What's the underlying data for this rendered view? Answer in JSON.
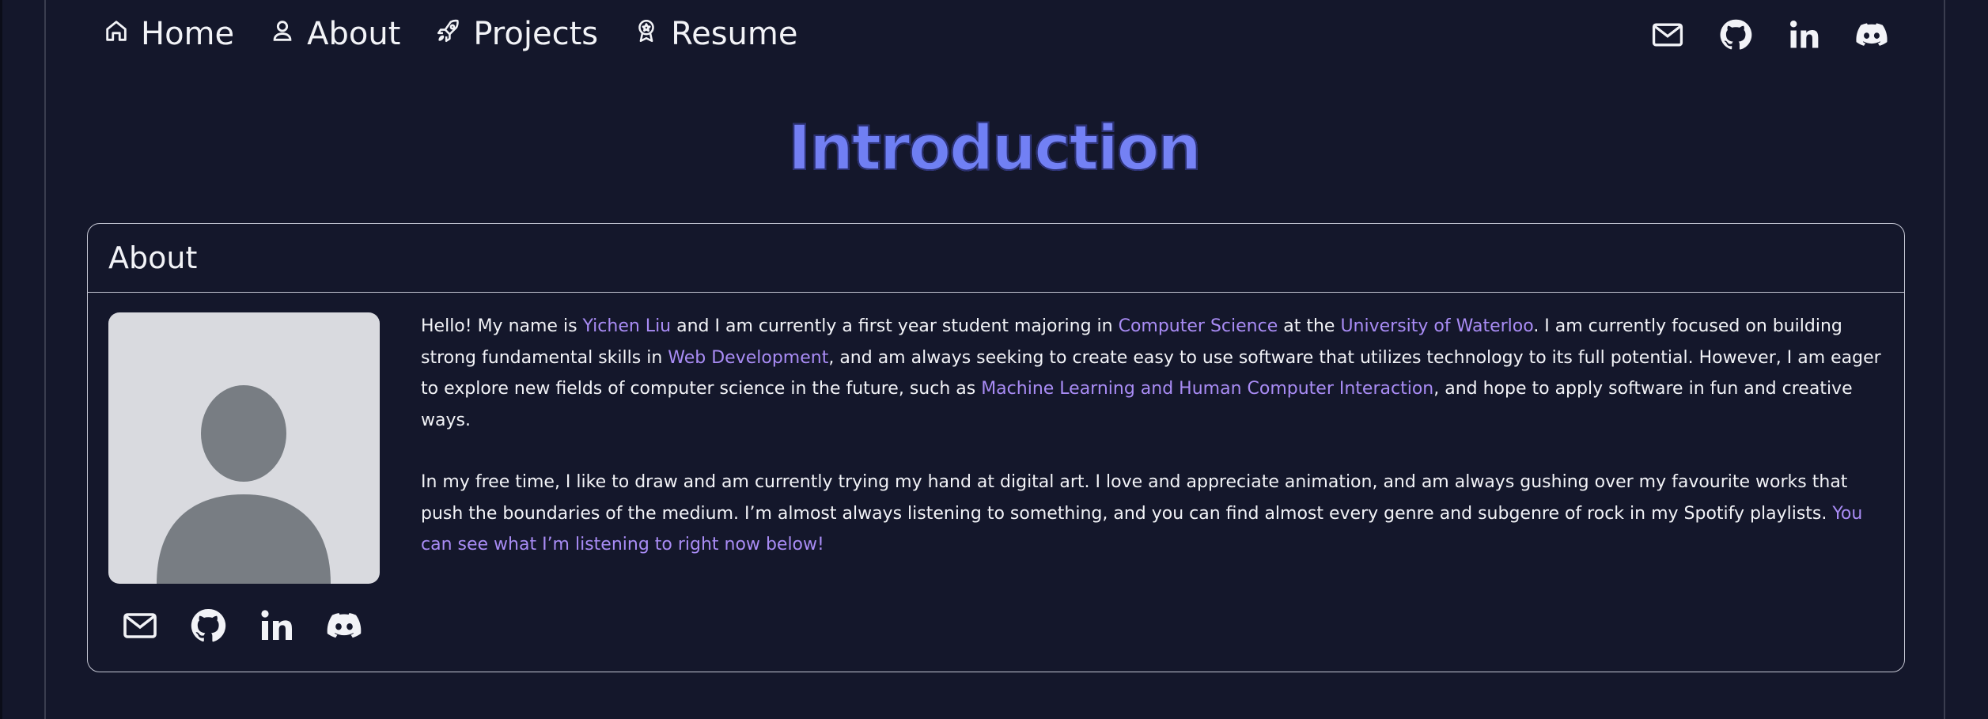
{
  "nav": {
    "items": [
      {
        "label": "Home",
        "icon": "home-icon"
      },
      {
        "label": "About",
        "icon": "person-icon"
      },
      {
        "label": "Projects",
        "icon": "rocket-icon"
      },
      {
        "label": "Resume",
        "icon": "award-icon"
      }
    ]
  },
  "social": [
    "mail-icon",
    "github-icon",
    "linkedin-icon",
    "discord-icon"
  ],
  "page_title": "Introduction",
  "card": {
    "title": "About",
    "bio": {
      "p1": [
        "Hello! My name is ",
        "Yichen Liu",
        " and I am currently a first year student majoring in ",
        "Computer Science",
        " at the ",
        "University of Waterloo",
        ". I am currently focused on building strong fundamental skills in ",
        "Web Development",
        ", and am always seeking to create easy to use software that utilizes technology to its full potential. However, I am eager to explore new fields of computer science in the future, such as ",
        "Machine Learning and Human Computer Interaction",
        ", and hope to apply software in fun and creative ways."
      ],
      "p2": [
        "In my free time, I like to draw and am currently trying my hand at digital art. I love and appreciate animation, and am always gushing over my favourite works that push the boundaries of the medium. I’m almost always listening to something, and you can find almost every genre and subgenre of rock in my Spotify playlists. ",
        "You can see what I’m listening to right now below!"
      ]
    }
  },
  "colors": {
    "background": "#14172b",
    "accent": "#a98cf5",
    "text": "#f2f3f7",
    "border": "#c5c7d4"
  }
}
